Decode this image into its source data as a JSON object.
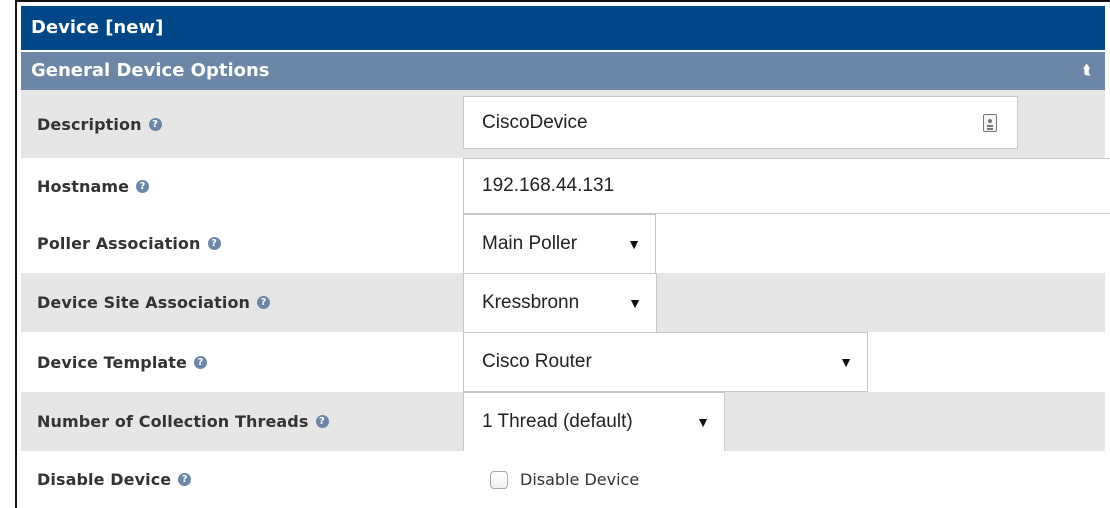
{
  "title": "Device [new]",
  "section": {
    "title": "General Device Options",
    "collapse_icon": "double-chevron-up-icon"
  },
  "fields": {
    "description": {
      "label": "Description",
      "value": "CiscoDevice"
    },
    "hostname": {
      "label": "Hostname",
      "value": "192.168.44.131"
    },
    "poller": {
      "label": "Poller Association",
      "value": "Main Poller"
    },
    "site": {
      "label": "Device Site Association",
      "value": "Kressbronn"
    },
    "template": {
      "label": "Device Template",
      "value": "Cisco Router"
    },
    "threads": {
      "label": "Number of Collection Threads",
      "value": "1 Thread (default)"
    },
    "disable": {
      "label": "Disable Device",
      "checkbox_label": "Disable Device",
      "checked": false
    }
  },
  "colors": {
    "title_bg": "#004787",
    "section_bg": "#6c86a8",
    "row_shade": "#e6e6e6",
    "text": "#333333"
  },
  "icons": {
    "help": "help-icon",
    "dropdown": "dropdown-arrow-icon",
    "contact": "contact-card-icon"
  }
}
